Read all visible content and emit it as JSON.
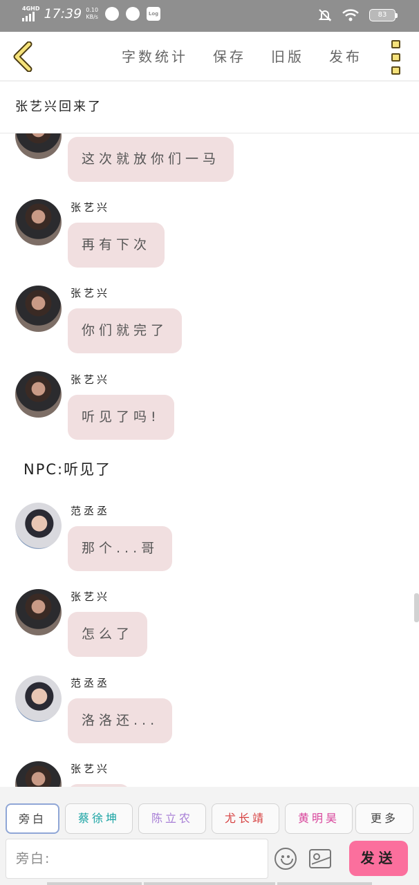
{
  "status_bar": {
    "network": "4GHD",
    "time": "17:39",
    "speed_value": "0.10",
    "speed_unit": "KB/s",
    "log_label": "Log",
    "battery": "83"
  },
  "appbar": {
    "word_count": "字数统计",
    "save": "保存",
    "old_version": "旧版",
    "publish": "发布"
  },
  "chapter_title": "张艺兴回来了",
  "messages": [
    {
      "text": "这次就放你们一马"
    },
    {
      "name": "张艺兴",
      "text": "再有下次"
    },
    {
      "name": "张艺兴",
      "text": "你们就完了"
    },
    {
      "name": "张艺兴",
      "text": "听见了吗!"
    },
    {
      "narration": "NPC:听见了"
    },
    {
      "name": "范丞丞",
      "text": "那个...哥"
    },
    {
      "name": "张艺兴",
      "text": "怎么了"
    },
    {
      "name": "范丞丞",
      "text": "洛洛还..."
    },
    {
      "name": "张艺兴"
    }
  ],
  "roles": [
    "旁白",
    "蔡徐坤",
    "陈立农",
    "尤长靖",
    "黄明昊",
    "更多"
  ],
  "role_colors": [
    "#444444",
    "#18a3a3",
    "#a87fd6",
    "#d64040",
    "#d8449b",
    "#444444"
  ],
  "composer": {
    "placeholder": "旁白:",
    "send": "发送"
  }
}
